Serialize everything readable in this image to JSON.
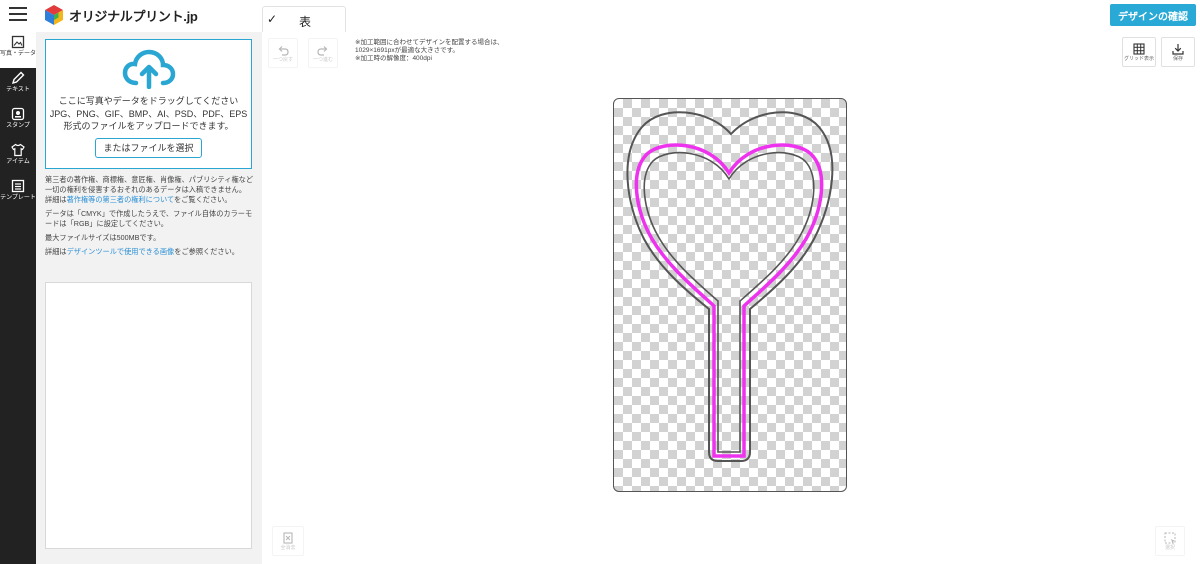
{
  "header": {
    "logo_text": "オリジナルプリント.jp",
    "side_tab_label": "表",
    "confirm_button": "デザインの確認"
  },
  "rail": [
    {
      "label": "写真・データ",
      "icon": "image-icon",
      "active": true
    },
    {
      "label": "テキスト",
      "icon": "pencil-icon"
    },
    {
      "label": "スタンプ",
      "icon": "stamp-icon"
    },
    {
      "label": "アイテム",
      "icon": "tshirt-icon"
    },
    {
      "label": "テンプレート",
      "icon": "template-icon"
    }
  ],
  "upload": {
    "drop_line1": "ここに写真やデータをドラッグしてください",
    "drop_line2": "JPG、PNG、GIF、BMP、AI、PSD、PDF、EPS",
    "drop_line3": "形式のファイルをアップロードできます。",
    "choose_button": "またはファイルを選択",
    "note1": "第三者の著作権、商標権、意匠権、肖像権、パブリシティ権など一切の権利を侵害するおそれのあるデータは入稿できません。",
    "note2_prefix": "詳細は",
    "note2_link": "著作権等の第三者の権利について",
    "note2_suffix": "をご覧ください。",
    "note3": "データは「CMYK」で作成したうえで、ファイル自体のカラーモードは「RGB」に設定してください。",
    "note4": "最大ファイルサイズは500MBです。",
    "note5_prefix": "詳細は",
    "note5_link": "デザインツールで使用できる画像",
    "note5_suffix": "をご参照ください。"
  },
  "toolbar": {
    "undo_label": "一つ戻す",
    "redo_label": "一つ進む",
    "grid_label": "グリッド表示",
    "save_label": "保存",
    "delete_all_label": "全消去",
    "select_label": "選択"
  },
  "hint": {
    "line1": "※加工範囲に合わせてデザインを配置する場合は、",
    "line2": "1029×1691pxが最適な大きさです。",
    "line3": "※加工時の解像度：400dpi"
  },
  "colors": {
    "accent": "#29a9d6",
    "link": "#2a8fd6",
    "cut_line": "#ee33ee",
    "outline": "#555555"
  }
}
